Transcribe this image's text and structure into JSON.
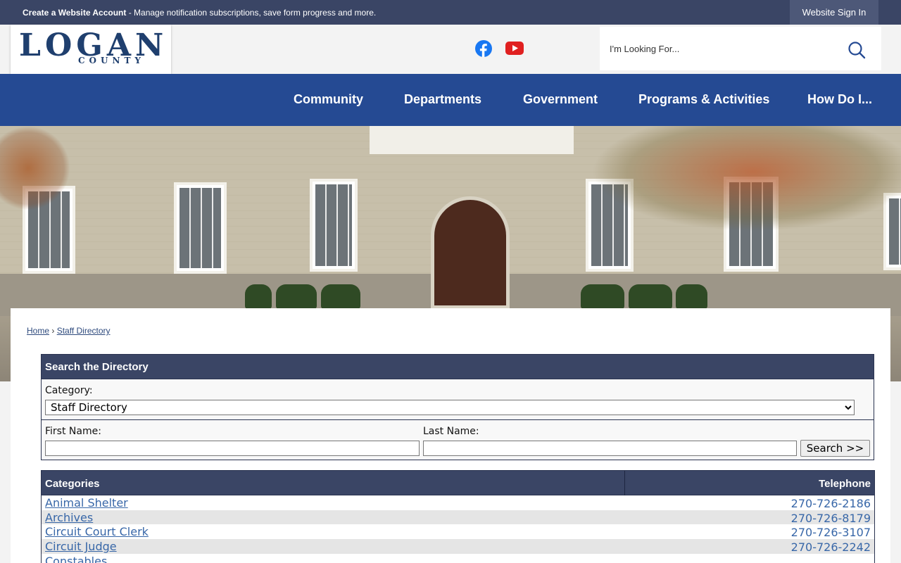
{
  "topbar": {
    "account_link": "Create a Website Account",
    "account_message": " - Manage notification subscriptions, save form progress and more.",
    "signin_label": "Website Sign In"
  },
  "header": {
    "logo_word": "LOGAN",
    "logo_sub": "COUNTY",
    "search_placeholder": "I'm Looking For..."
  },
  "nav": {
    "items": [
      "Community",
      "Departments",
      "Government",
      "Programs & Activities",
      "How Do I..."
    ]
  },
  "breadcrumb": {
    "home": "Home",
    "separator": "›",
    "current": "Staff Directory"
  },
  "search_panel": {
    "title": "Search the Directory",
    "category_label": "Category:",
    "category_selected": "Staff Directory",
    "first_name_label": "First Name:",
    "last_name_label": "Last Name:",
    "search_button": "Search >>"
  },
  "categories_table": {
    "headers": [
      "Categories",
      "Telephone"
    ],
    "rows": [
      {
        "name": "Animal Shelter",
        "phone": "270-726-2186"
      },
      {
        "name": "Archives",
        "phone": "270-726-8179"
      },
      {
        "name": "Circuit Court Clerk",
        "phone": "270-726-3107"
      },
      {
        "name": "Circuit Judge",
        "phone": "270-726-2242"
      },
      {
        "name": "Constables",
        "phone": ""
      }
    ]
  },
  "colors": {
    "topbar": "#3a4565",
    "nav": "#254a93",
    "link": "#3867a8",
    "facebook": "#1877f2",
    "youtube": "#e02020"
  }
}
